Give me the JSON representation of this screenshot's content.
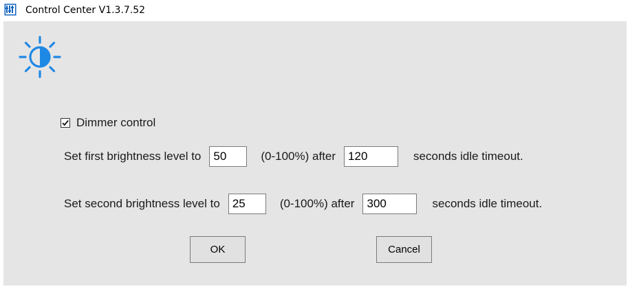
{
  "window": {
    "title": "Control Center V1.3.7.52"
  },
  "icons": {
    "app": "app-icon",
    "brightness": "brightness-icon"
  },
  "dimmer": {
    "label": "Dimmer control",
    "checked": true
  },
  "first_level": {
    "prefix": "Set first brightness level to",
    "percent_value": "50",
    "middle": "(0-100%) after",
    "seconds_value": "120",
    "suffix": "seconds idle timeout."
  },
  "second_level": {
    "prefix": "Set second brightness level to",
    "percent_value": "25",
    "middle": "(0-100%) after",
    "seconds_value": "300",
    "suffix": "seconds idle timeout."
  },
  "buttons": {
    "ok": "OK",
    "cancel": "Cancel"
  },
  "colors": {
    "accent": "#1e88e5",
    "client_bg": "#e5e5e5"
  }
}
